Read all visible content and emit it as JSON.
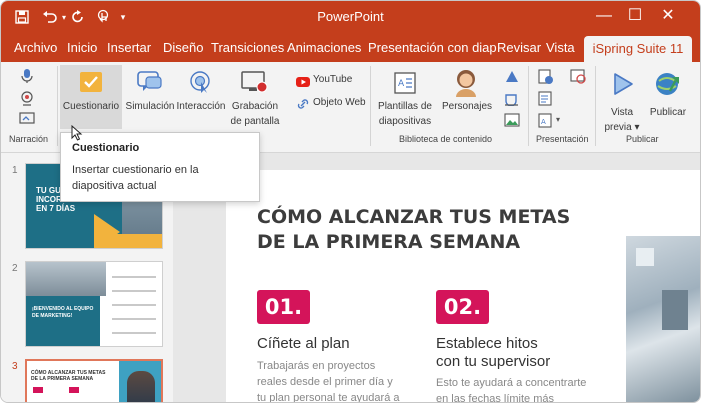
{
  "app": {
    "title": "PowerPoint"
  },
  "colors": {
    "brand": "#c43e1c",
    "accent_pink": "#d4145a",
    "teal": "#1e6f86",
    "slide_title": "#3c3c3c"
  },
  "quick_access": {
    "save_icon": "save-icon",
    "undo_icon": "undo-icon",
    "redo_icon": "redo-icon",
    "touch_icon": "touch-mode-icon",
    "customize_icon": "customize-icon"
  },
  "tabs": [
    "Archivo",
    "Inicio",
    "Insertar",
    "Diseño",
    "Transiciones",
    "Animaciones",
    "Presentación con diap",
    "Revisar",
    "Vista"
  ],
  "active_tab": "iSpring Suite 11",
  "ribbon": {
    "narration_label": "Narración",
    "quiz": "Cuestionario",
    "simulation": "Simulación",
    "interaction": "Interacción",
    "recording_line1": "Grabación",
    "recording_line2": "de pantalla",
    "youtube": "YouTube",
    "web_object": "Objeto Web",
    "templates_line1": "Plantillas de",
    "templates_line2": "diapositivas",
    "characters": "Personajes",
    "content_library": "Biblioteca de contenido",
    "presentation_group": "Presentación",
    "preview_line1": "Vista",
    "preview_line2": "previa",
    "publish": "Publicar",
    "publish_group": "Publicar"
  },
  "tooltip": {
    "title": "Cuestionario",
    "body": "Insertar cuestionario en la diapositiva actual"
  },
  "thumbnails": [
    {
      "number": "1",
      "title_line1": "TU GU",
      "title_line2": "INCOR",
      "title_line3": "EN 7 DÍAS"
    },
    {
      "number": "2",
      "title_line1": "¡BIENVENIDO AL EQUIPO",
      "title_line2": "DE MARKETING!"
    },
    {
      "number": "3",
      "title_line1": "CÓMO ALCANZAR TUS METAS",
      "title_line2": "DE LA PRIMERA SEMANA"
    }
  ],
  "slide": {
    "title_line1": "CÓMO ALCANZAR TUS METAS",
    "title_line2": "DE LA PRIMERA SEMANA",
    "card1": {
      "number": "01.",
      "heading": "Cíñete al plan",
      "text_line1": "Trabajarás en proyectos",
      "text_line2": "reales desde el primer día y",
      "text_line3": "tu plan personal te ayudará a"
    },
    "card2": {
      "number": "02.",
      "heading_line1": "Establece hitos",
      "heading_line2": "con tu supervisor",
      "text_line1": "Esto te ayudará a concentrarte",
      "text_line2": "en las fechas límite más"
    }
  }
}
